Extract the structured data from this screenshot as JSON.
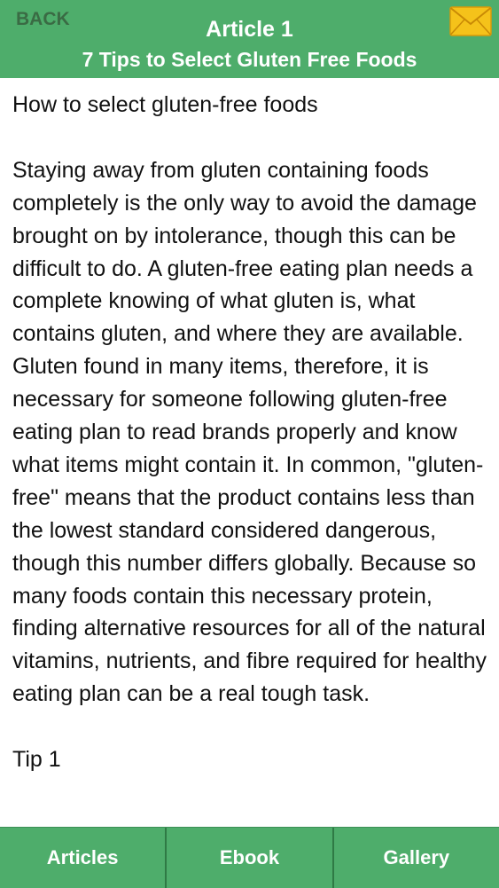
{
  "header": {
    "back_label": "BACK",
    "title": "Article 1",
    "subtitle": "7 Tips to Select Gluten Free Foods",
    "mail_icon": "envelope-icon"
  },
  "colors": {
    "header_bg": "#4ead6b",
    "tabbar_bg": "#4ead6b",
    "envelope": "#f5c21a"
  },
  "article": {
    "heading": "How to select gluten-free foods",
    "body": "Staying away from gluten containing foods completely is the only way to avoid the damage brought on by intolerance, though this can be difficult to do. A gluten-free eating plan needs a complete knowing of what gluten is, what contains gluten, and where they are available. Gluten found in many items, therefore, it is necessary for someone following gluten-free eating plan to read brands properly and know what items might contain it. In common, \"gluten-free\" means that the product contains less than the lowest standard considered dangerous, though this number differs globally. Because so many foods contain this necessary protein, finding alternative resources for all of the natural vitamins, nutrients, and fibre required for healthy eating plan can be a real tough task.",
    "next_heading": "Tip 1"
  },
  "tabbar": {
    "items": [
      {
        "label": "Articles"
      },
      {
        "label": "Ebook"
      },
      {
        "label": "Gallery"
      }
    ]
  }
}
